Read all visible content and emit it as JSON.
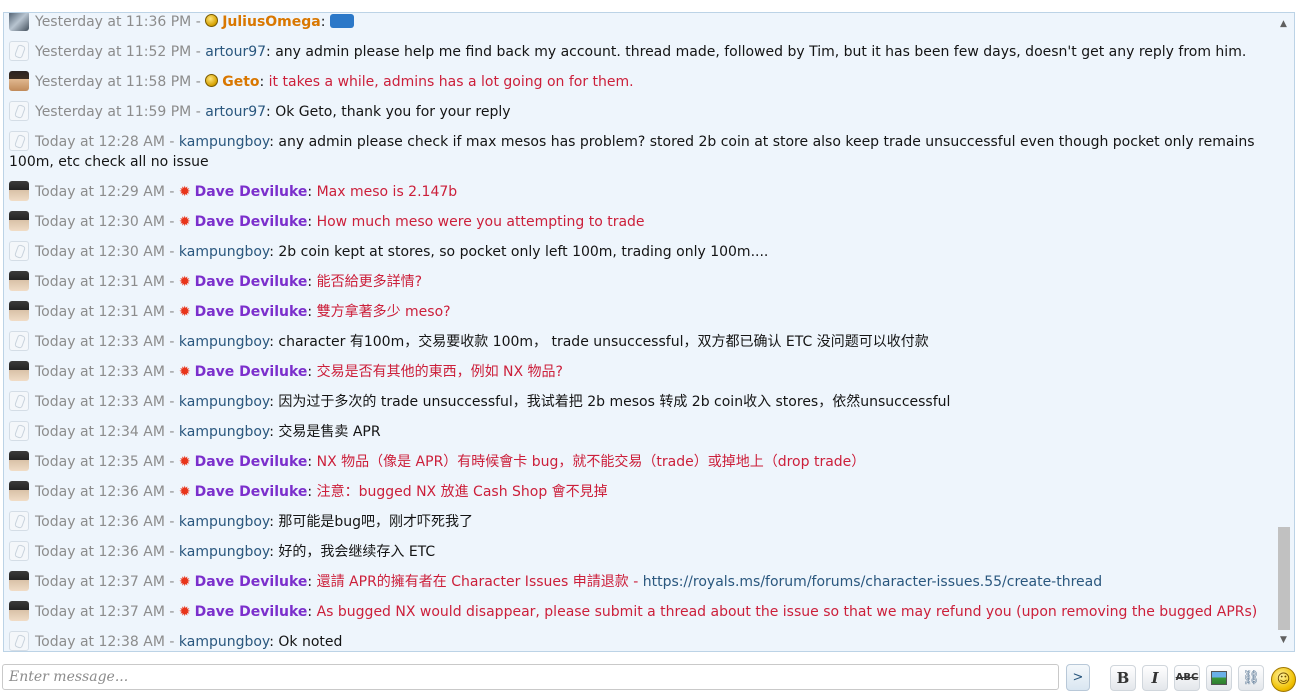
{
  "messages": [
    {
      "time": "Yesterday at 11:36 PM",
      "user": "JuliusOmega",
      "user_style": "orange",
      "avatar": "julius",
      "badge": "coin",
      "text": "",
      "text_style": "plain",
      "emote": true
    },
    {
      "time": "Yesterday at 11:52 PM",
      "user": "artour97",
      "user_style": "normal",
      "avatar": "default",
      "badge": "",
      "text": "any admin please help me find back my account. thread made, followed by Tim, but it has been few days, doesn't get any reply from him.",
      "text_style": "plain"
    },
    {
      "time": "Yesterday at 11:58 PM",
      "user": "Geto",
      "user_style": "orange",
      "avatar": "geto",
      "badge": "coin",
      "text": "it takes a while, admins has a lot going on for them.",
      "text_style": "red"
    },
    {
      "time": "Yesterday at 11:59 PM",
      "user": "artour97",
      "user_style": "normal",
      "avatar": "default",
      "badge": "",
      "text": "Ok Geto, thank you for your reply",
      "text_style": "plain"
    },
    {
      "time": "Today at 12:28 AM",
      "user": "kampungboy",
      "user_style": "normal",
      "avatar": "default",
      "badge": "",
      "text": "any admin please check if max mesos has problem? stored 2b coin at store also keep trade unsuccessful even though pocket only remains 100m, etc check all no issue",
      "text_style": "plain"
    },
    {
      "time": "Today at 12:29 AM",
      "user": "Dave Deviluke",
      "user_style": "dave",
      "avatar": "dave",
      "badge": "leaf",
      "text": "Max meso is 2.147b",
      "text_style": "red"
    },
    {
      "time": "Today at 12:30 AM",
      "user": "Dave Deviluke",
      "user_style": "dave",
      "avatar": "dave",
      "badge": "leaf",
      "text": "How much meso were you attempting to trade",
      "text_style": "red"
    },
    {
      "time": "Today at 12:30 AM",
      "user": "kampungboy",
      "user_style": "normal",
      "avatar": "default",
      "badge": "",
      "text": "2b coin kept at stores, so pocket only left 100m, trading only 100m....",
      "text_style": "plain"
    },
    {
      "time": "Today at 12:31 AM",
      "user": "Dave Deviluke",
      "user_style": "dave",
      "avatar": "dave",
      "badge": "leaf",
      "text": "能否給更多詳情?",
      "text_style": "red"
    },
    {
      "time": "Today at 12:31 AM",
      "user": "Dave Deviluke",
      "user_style": "dave",
      "avatar": "dave",
      "badge": "leaf",
      "text": "雙方拿著多少 meso?",
      "text_style": "red"
    },
    {
      "time": "Today at 12:33 AM",
      "user": "kampungboy",
      "user_style": "normal",
      "avatar": "default",
      "badge": "",
      "text": "character 有100m，交易要收款 100m， trade unsuccessful，双方都已确认 ETC 没问题可以收付款",
      "text_style": "plain"
    },
    {
      "time": "Today at 12:33 AM",
      "user": "Dave Deviluke",
      "user_style": "dave",
      "avatar": "dave",
      "badge": "leaf",
      "text": "交易是否有其他的東西，例如 NX 物品?",
      "text_style": "red"
    },
    {
      "time": "Today at 12:33 AM",
      "user": "kampungboy",
      "user_style": "normal",
      "avatar": "default",
      "badge": "",
      "text": "因为过于多次的 trade unsuccessful，我试着把 2b mesos 转成 2b coin收入 stores，依然unsuccessful",
      "text_style": "plain"
    },
    {
      "time": "Today at 12:34 AM",
      "user": "kampungboy",
      "user_style": "normal",
      "avatar": "default",
      "badge": "",
      "text": "交易是售卖 APR",
      "text_style": "plain"
    },
    {
      "time": "Today at 12:35 AM",
      "user": "Dave Deviluke",
      "user_style": "dave",
      "avatar": "dave",
      "badge": "leaf",
      "text": "NX 物品（像是 APR）有時候會卡 bug，就不能交易（trade）或掉地上（drop trade）",
      "text_style": "red"
    },
    {
      "time": "Today at 12:36 AM",
      "user": "Dave Deviluke",
      "user_style": "dave",
      "avatar": "dave",
      "badge": "leaf",
      "text": "注意：bugged NX 放進 Cash Shop 會不見掉",
      "text_style": "red"
    },
    {
      "time": "Today at 12:36 AM",
      "user": "kampungboy",
      "user_style": "normal",
      "avatar": "default",
      "badge": "",
      "text": "那可能是bug吧，刚才吓死我了",
      "text_style": "plain"
    },
    {
      "time": "Today at 12:36 AM",
      "user": "kampungboy",
      "user_style": "normal",
      "avatar": "default",
      "badge": "",
      "text": "好的，我会继续存入 ETC",
      "text_style": "plain"
    },
    {
      "time": "Today at 12:37 AM",
      "user": "Dave Deviluke",
      "user_style": "dave",
      "avatar": "dave",
      "badge": "leaf",
      "text": "還請 APR的擁有者在 Character Issues 申請退款 - ",
      "text_style": "red",
      "link": "https://royals.ms/forum/forums/character-issues.55/create-thread"
    },
    {
      "time": "Today at 12:37 AM",
      "user": "Dave Deviluke",
      "user_style": "dave",
      "avatar": "dave",
      "badge": "leaf",
      "text": "As bugged NX would disappear, please submit a thread about the issue so that we may refund you (upon removing the bugged APRs)",
      "text_style": "red"
    },
    {
      "time": "Today at 12:38 AM",
      "user": "kampungboy",
      "user_style": "normal",
      "avatar": "default",
      "badge": "",
      "text": "Ok noted",
      "text_style": "plain"
    }
  ],
  "separator": " - ",
  "colon": ": ",
  "input": {
    "placeholder": "Enter message..."
  },
  "send_label": ">",
  "toolbar": {
    "bold": "B",
    "italic": "I",
    "strike": "ABC",
    "link": "⛓",
    "smiley": "☺"
  },
  "colors": {
    "panel_bg": "#eef5fc",
    "username": "#2a577e",
    "staff_name": "#7b2fcc",
    "orange_name": "#d97700",
    "red_text": "#cc1f3a",
    "timestamp": "#8c8c8c"
  }
}
